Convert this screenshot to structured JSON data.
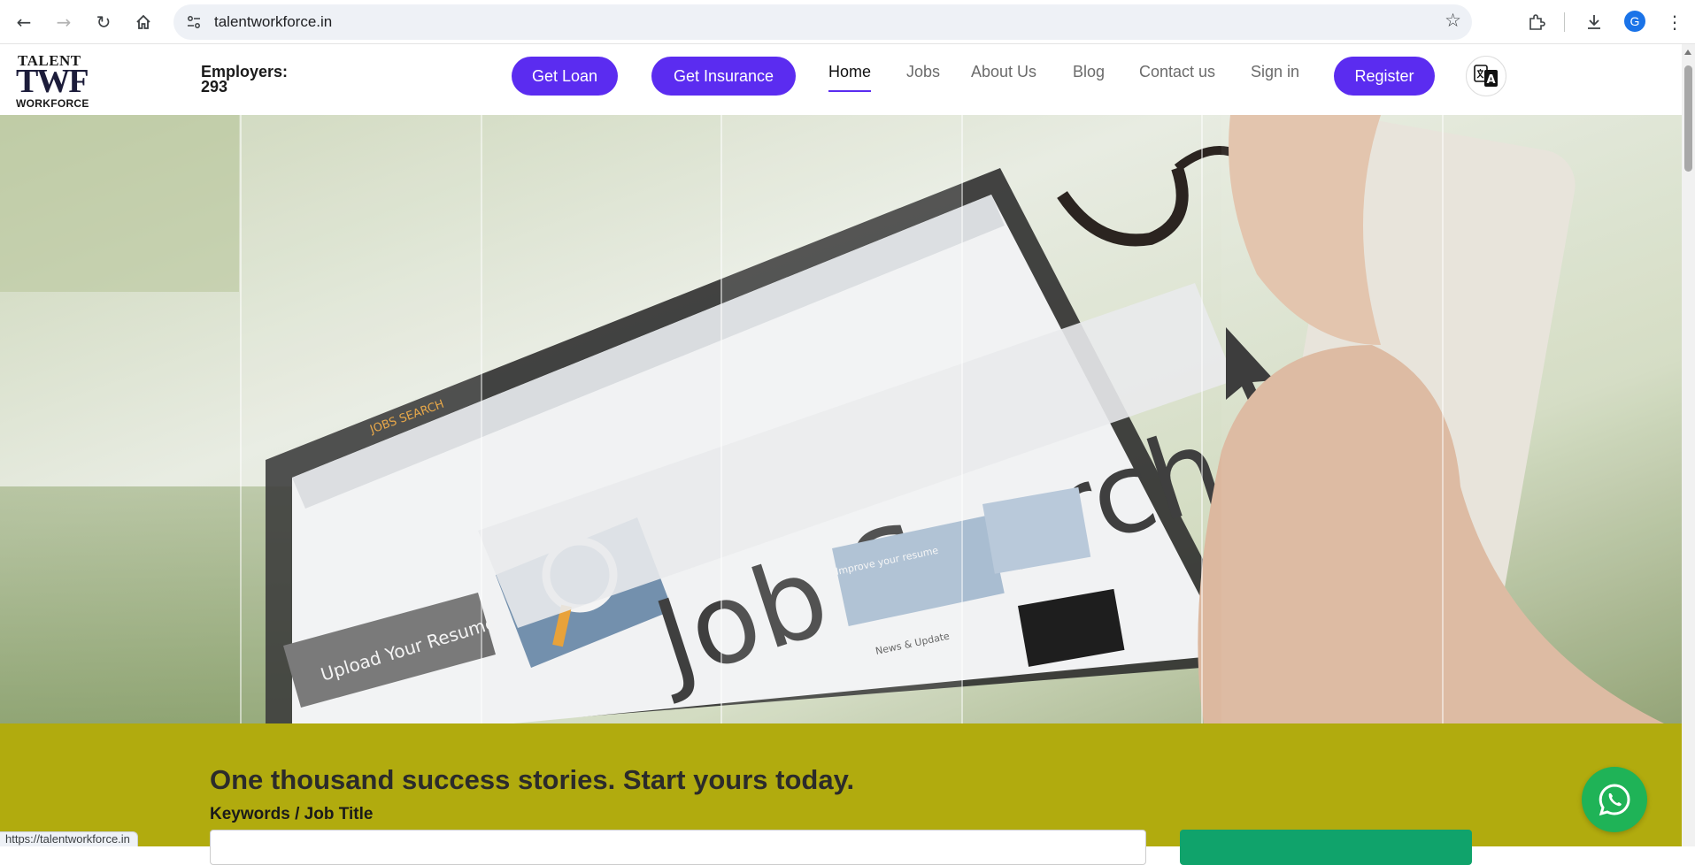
{
  "browser": {
    "url": "talentworkforce.in",
    "status_url": "https://talentworkforce.in",
    "profile_initial": "G"
  },
  "site": {
    "logo": {
      "line1": "TALENT",
      "line2": "TWF",
      "line3": "WORKFORCE"
    },
    "employers_label": "Employers:",
    "employers_count": "293",
    "buttons": {
      "loan": "Get Loan",
      "insurance": "Get Insurance",
      "register": "Register"
    },
    "nav": [
      {
        "label": "Home",
        "active": true
      },
      {
        "label": "Jobs",
        "active": false
      },
      {
        "label": "About Us",
        "active": false
      },
      {
        "label": "Blog",
        "active": false
      },
      {
        "label": "Contact us",
        "active": false
      },
      {
        "label": "Sign in",
        "active": false
      }
    ],
    "brand_color": "#5b2cf0"
  },
  "hero": {
    "image_text": "Job Search",
    "image_small_text": [
      "JOBS SEARCH",
      "Upload Your Resume",
      "Improve your resume",
      "News & Update"
    ]
  },
  "search": {
    "headline": "One thousand success stories. Start yours today.",
    "keywords_label": "Keywords / Job Title",
    "band_color": "#b1ab0e"
  }
}
